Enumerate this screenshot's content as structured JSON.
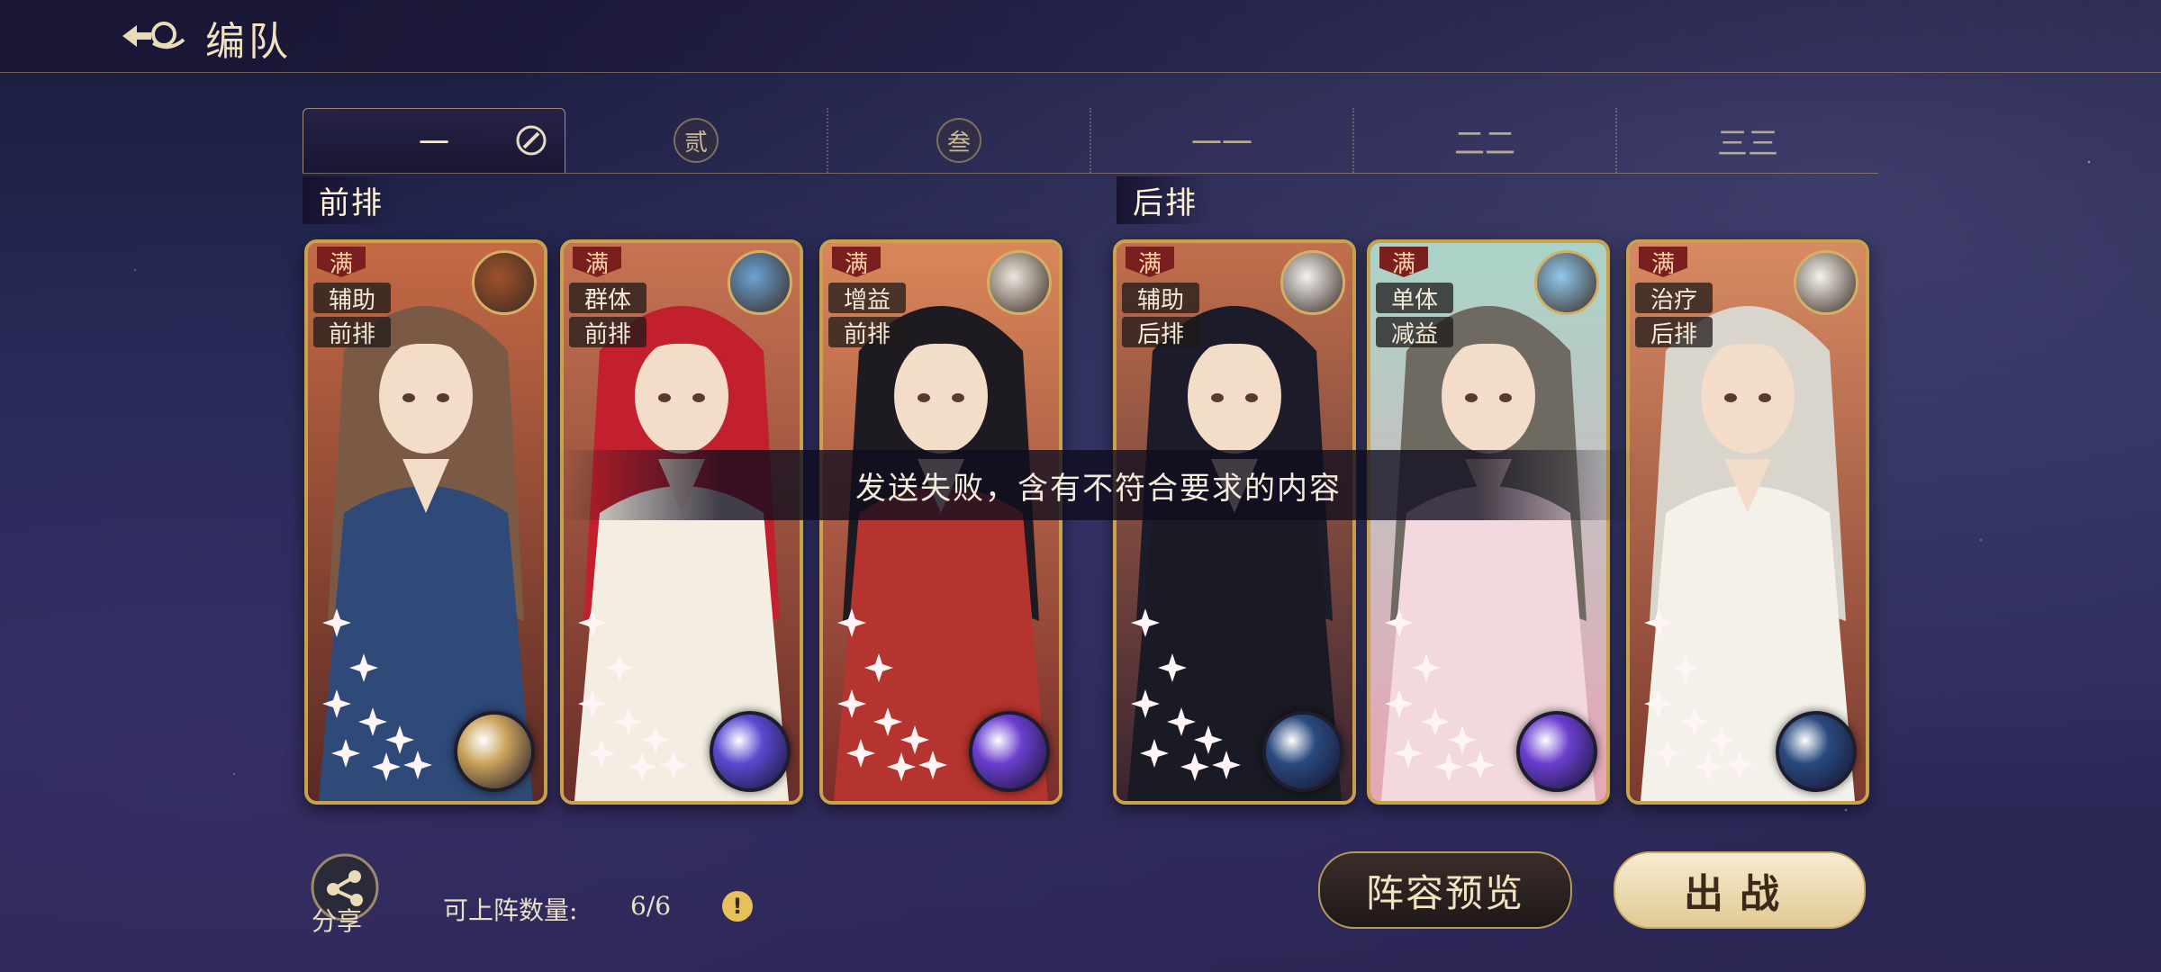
{
  "header": {
    "title": "编队"
  },
  "tabs": [
    {
      "label": "一",
      "active": true
    },
    {
      "label": "贰",
      "active": false
    },
    {
      "label": "叁",
      "active": false
    },
    {
      "label": "一一",
      "active": false
    },
    {
      "label": "二二",
      "active": false
    },
    {
      "label": "三三",
      "active": false
    }
  ],
  "rows": {
    "front": "前排",
    "back": "后排"
  },
  "cards": [
    {
      "flag": "满",
      "tag1": "辅助",
      "tag2": "前排",
      "hair": "#7a5a45",
      "robe": "#2f4a78",
      "bg1": "#c56a45",
      "bg2": "#5a2a25",
      "pet": "#a0522d",
      "orb": "#caa25a"
    },
    {
      "flag": "满",
      "tag1": "群体",
      "tag2": "前排",
      "hair": "#c2202c",
      "robe": "#f4ede2",
      "bg1": "#c77452",
      "bg2": "#6a2d28",
      "pet": "#6aa3d6",
      "orb": "#5b4ad1"
    },
    {
      "flag": "满",
      "tag1": "增益",
      "tag2": "前排",
      "hair": "#1d1a22",
      "robe": "#b5342f",
      "bg1": "#d9875a",
      "bg2": "#7a2d2a",
      "pet": "#ece7de",
      "orb": "#6b3fd0"
    },
    {
      "flag": "满",
      "tag1": "辅助",
      "tag2": "后排",
      "hair": "#1b1b2a",
      "robe": "#1a1a24",
      "bg1": "#c26f4c",
      "bg2": "#3a2430",
      "pet": "#f2f2f2",
      "orb": "#2a4a80"
    },
    {
      "flag": "满",
      "tag1": "单体",
      "tag2": "减益",
      "hair": "#6e6a62",
      "robe": "#f3d9dd",
      "bg1": "#a9d4c8",
      "bg2": "#e8a6b6",
      "pet": "#8fc9ee",
      "orb": "#6b3fd0"
    },
    {
      "flag": "满",
      "tag1": "治疗",
      "tag2": "后排",
      "hair": "#d9d4cc",
      "robe": "#f4f1ea",
      "bg1": "#d78a62",
      "bg2": "#7b3a2e",
      "pet": "#f5f3ee",
      "orb": "#2a4a80"
    }
  ],
  "toast": "发送失败，含有不符合要求的内容",
  "bottom": {
    "share_label": "分享",
    "deploy_label": "可上阵数量:",
    "deploy_count": "6/6",
    "info_icon": "!",
    "preview_button": "阵容预览",
    "battle_button": "出战"
  }
}
